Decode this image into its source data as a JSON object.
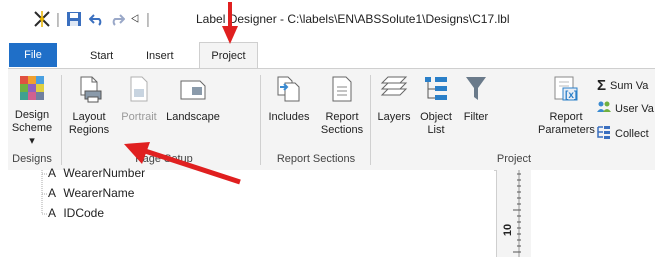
{
  "window": {
    "title": "Label Designer - C:\\labels\\EN\\ABSSolute1\\Designs\\C17.lbl",
    "quick_access": {
      "app_icon": "x-cross-icon",
      "save_icon": "save-icon",
      "undo_icon": "undo-icon",
      "redo_icon": "redo-icon",
      "customize_icon": "customize-dropdown-icon"
    }
  },
  "tabs": {
    "file": "File",
    "start": "Start",
    "insert": "Insert",
    "project": "Project"
  },
  "ribbon": {
    "design_scheme": {
      "line1": "Design",
      "line2": "Scheme ▾"
    },
    "layout_regions": {
      "line1": "Layout",
      "line2": "Regions"
    },
    "portrait": "Portrait",
    "landscape": "Landscape",
    "includes": "Includes",
    "report_sections_btn": {
      "line1": "Report",
      "line2": "Sections"
    },
    "layers": "Layers",
    "object_list": {
      "line1": "Object",
      "line2": "List"
    },
    "filter": "Filter",
    "report_parameters": {
      "line1": "Report",
      "line2": "Parameters"
    },
    "sum_variables": "Sum Va",
    "user_variables": "User Va",
    "collections": "Collect",
    "groups": {
      "designs": "Designs",
      "page_setup": "Page Setup",
      "report_sections": "Report Sections",
      "project": "Project"
    }
  },
  "tree": {
    "items": [
      {
        "type": "A",
        "name": "WearerNumber"
      },
      {
        "type": "A",
        "name": "WearerName"
      },
      {
        "type": "A",
        "name": "IDCode"
      }
    ]
  },
  "ruler": {
    "mark": "10"
  },
  "colors": {
    "accent": "#1f6fc8",
    "annotation": "#e02020",
    "ribbon_bg": "#f4f4f4"
  }
}
